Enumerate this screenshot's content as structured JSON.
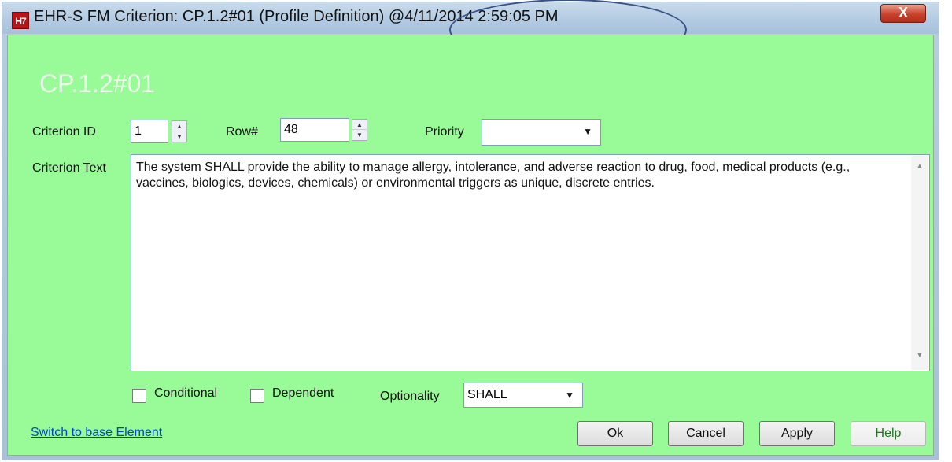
{
  "window": {
    "app_icon_text": "H7",
    "title": "EHR-S FM Criterion: CP.1.2#01 (Profile Definition) @4/11/2014 2:59:05 PM",
    "close_label": "X"
  },
  "heading": "CP.1.2#01",
  "fields": {
    "criterion_id_label": "Criterion ID",
    "criterion_id_value": "1",
    "row_label": "Row#",
    "row_value": "48",
    "priority_label": "Priority",
    "priority_value": "",
    "criterion_text_label": "Criterion Text",
    "criterion_text_value": "The system SHALL provide the ability to manage allergy, intolerance, and adverse reaction to drug, food, medical products (e.g., vaccines, biologics, devices, chemicals) or environmental triggers as unique, discrete entries.",
    "conditional_label": "Conditional",
    "conditional_checked": false,
    "dependent_label": "Dependent",
    "dependent_checked": false,
    "optionality_label": "Optionality",
    "optionality_value": "SHALL"
  },
  "footer": {
    "switch_link": "Switch to base Element",
    "ok_label": "Ok",
    "cancel_label": "Cancel",
    "apply_label": "Apply",
    "help_label": "Help"
  },
  "colors": {
    "client_bg": "#98fb98",
    "heading_text": "#e9ffe9",
    "annotation_ellipse": "#3a5288",
    "link": "#0044cc"
  }
}
